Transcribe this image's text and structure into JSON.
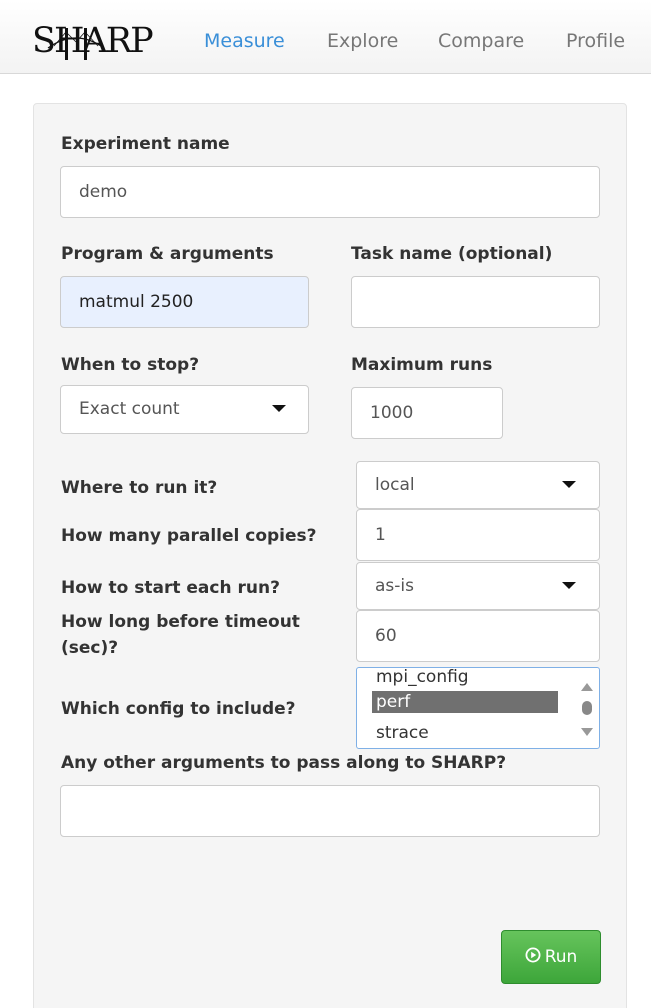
{
  "brand": {
    "logo_text": "SHARP"
  },
  "nav": {
    "items": [
      {
        "label": "Measure",
        "active": true
      },
      {
        "label": "Explore",
        "active": false
      },
      {
        "label": "Compare",
        "active": false
      },
      {
        "label": "Profile",
        "active": false
      }
    ]
  },
  "form": {
    "experiment_name": {
      "label": "Experiment name",
      "value": "demo"
    },
    "program_arguments": {
      "label": "Program & arguments",
      "value": "matmul 2500"
    },
    "task_name": {
      "label": "Task name (optional)",
      "value": ""
    },
    "when_to_stop": {
      "label": "When to stop?",
      "value": "Exact count"
    },
    "maximum_runs": {
      "label": "Maximum runs",
      "value": "1000"
    },
    "where_to_run": {
      "label": "Where to run it?",
      "value": "local"
    },
    "parallel_copies": {
      "label": "How many parallel copies?",
      "value": "1"
    },
    "start_each_run": {
      "label": "How to start each run?",
      "value": "as-is"
    },
    "timeout": {
      "label_line1": "How long before timeout",
      "label_line2": "(sec)?",
      "value": "60"
    },
    "config_include": {
      "label": "Which config to include?",
      "options": [
        "mpi_config",
        "perf",
        "strace"
      ],
      "selected": "perf"
    },
    "other_arguments": {
      "label": "Any other arguments to pass along to SHARP?",
      "value": ""
    }
  },
  "actions": {
    "run_label": "Run"
  },
  "colors": {
    "nav_active": "#3a8fd8",
    "nav_inactive": "#777777",
    "run_button": "#4cae4c",
    "autofill_bg": "#e8f0fe",
    "listbox_selected": "#707070"
  },
  "icons": {
    "run": "play-circle-icon",
    "dropdown": "caret-down-icon"
  }
}
